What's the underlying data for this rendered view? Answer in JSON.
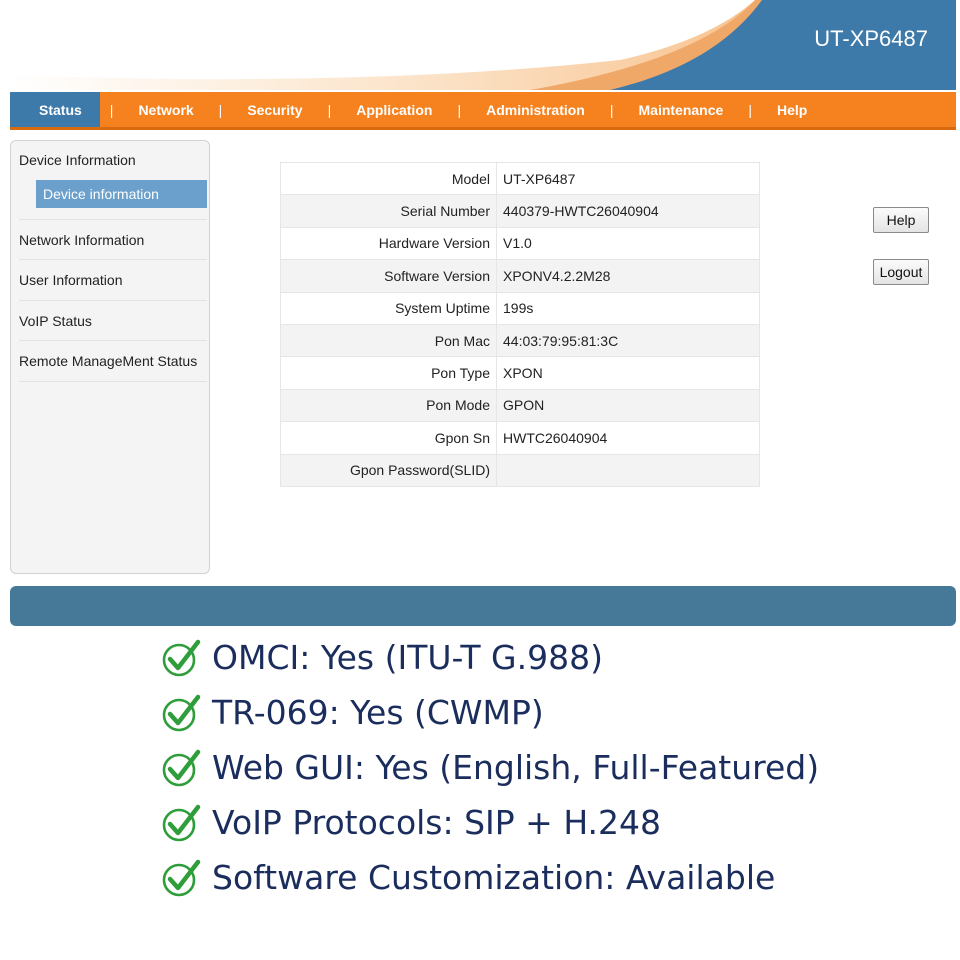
{
  "header": {
    "product_name": "UT-XP6487"
  },
  "nav": {
    "items": [
      {
        "label": "Status",
        "active": true
      },
      {
        "label": "Network"
      },
      {
        "label": "Security"
      },
      {
        "label": "Application"
      },
      {
        "label": "Administration"
      },
      {
        "label": "Maintenance"
      },
      {
        "label": "Help"
      }
    ],
    "separator": "|"
  },
  "sidebar": {
    "sections": [
      {
        "label": "Device Information",
        "sub": "Device information"
      },
      {
        "label": "Network Information"
      },
      {
        "label": "User Information"
      },
      {
        "label": "VoIP Status"
      },
      {
        "label": "Remote ManageMent Status"
      }
    ]
  },
  "device_info": {
    "rows": [
      {
        "key": "Model",
        "value": "UT-XP6487"
      },
      {
        "key": "Serial Number",
        "value": "440379-HWTC26040904"
      },
      {
        "key": "Hardware Version",
        "value": "V1.0"
      },
      {
        "key": "Software Version",
        "value": "XPONV4.2.2M28"
      },
      {
        "key": "System Uptime",
        "value": "199s"
      },
      {
        "key": "Pon Mac",
        "value": "44:03:79:95:81:3C"
      },
      {
        "key": "Pon Type",
        "value": "XPON"
      },
      {
        "key": "Pon Mode",
        "value": "GPON"
      },
      {
        "key": "Gpon Sn",
        "value": "HWTC26040904"
      },
      {
        "key": "Gpon Password(SLID)",
        "value": ""
      }
    ]
  },
  "buttons": {
    "help": "Help",
    "logout": "Logout"
  },
  "features": [
    "OMCI: Yes (ITU-T G.988)",
    "TR-069: Yes (CWMP)",
    "Web GUI: Yes (English, Full-Featured)",
    "VoIP Protocols: SIP + H.248",
    "Software Customization: Available"
  ],
  "icons": {
    "feature": "check-circle-icon"
  },
  "colors": {
    "nav": "#f5821f",
    "nav_active": "#3e7aa9",
    "header_blue": "#3e7aa9",
    "footer_bar": "#467998",
    "check": "#2f9e3a",
    "feature_text": "#1a2d5c"
  }
}
